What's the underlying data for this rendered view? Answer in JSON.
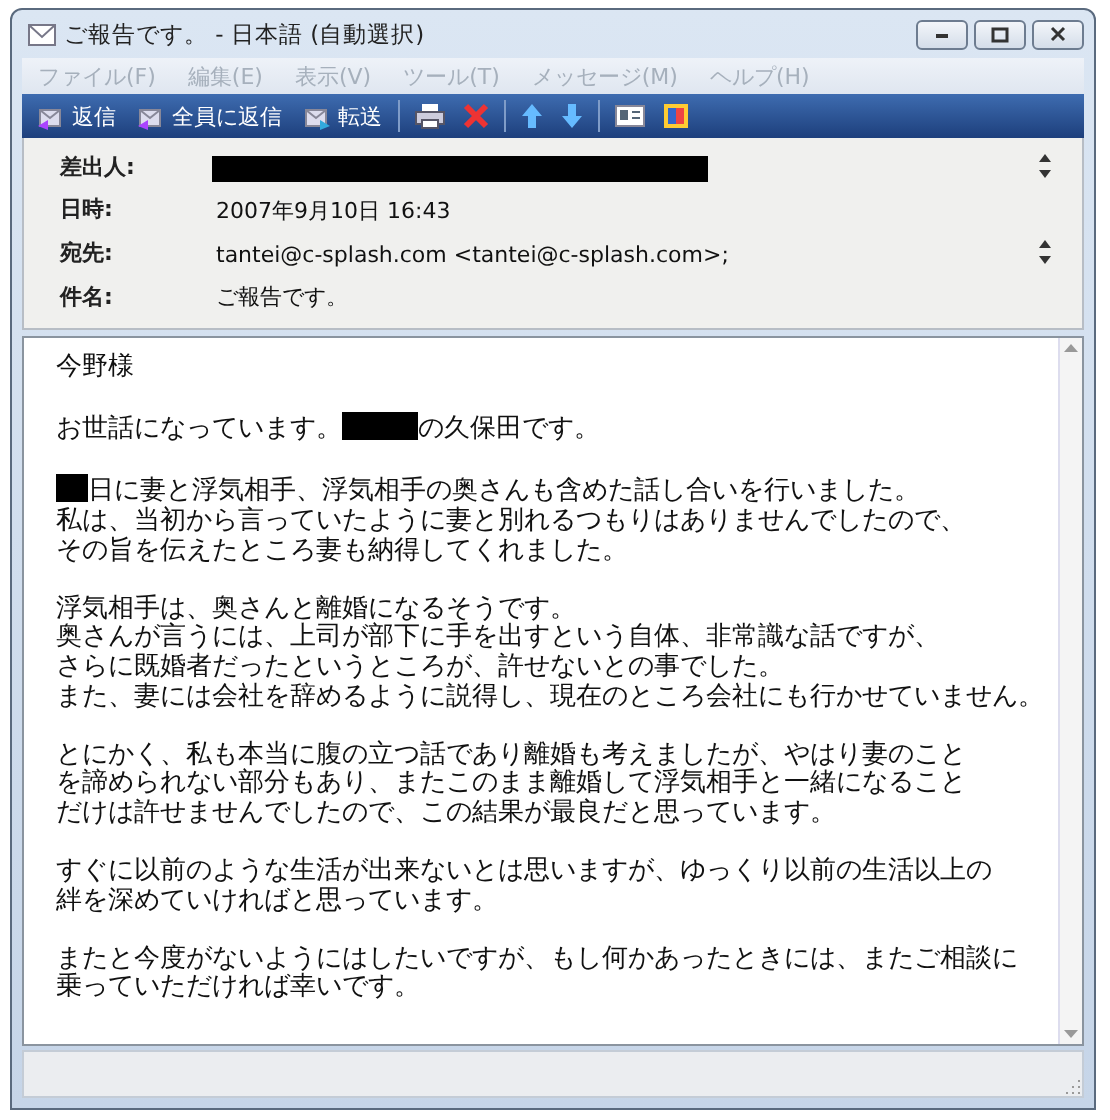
{
  "window": {
    "title": "ご報告です。 - 日本語 (自動選択)"
  },
  "menu": [
    "ファイル(F)",
    "編集(E)",
    "表示(V)",
    "ツール(T)",
    "メッセージ(M)",
    "ヘルプ(H)"
  ],
  "toolbar": [
    {
      "kind": "reply",
      "label": "返信"
    },
    {
      "kind": "reply-all",
      "label": "全員に返信"
    },
    {
      "kind": "forward",
      "label": "転送"
    },
    {
      "kind": "print"
    },
    {
      "kind": "delete"
    },
    {
      "kind": "previous"
    },
    {
      "kind": "next"
    },
    {
      "kind": "contacts"
    },
    {
      "kind": "encoding"
    }
  ],
  "header": [
    {
      "label": "差出人:",
      "redacted": true,
      "scroll": true
    },
    {
      "label": "日時:",
      "value": "2007年9月10日 16:43",
      "redacted": false,
      "scroll": false
    },
    {
      "label": "宛先:",
      "value": "tantei@c-splash.com <tantei@c-splash.com>;",
      "redacted": false,
      "scroll": true
    },
    {
      "label": "件名:",
      "value": "ご報告です。",
      "redacted": false,
      "scroll": false
    }
  ],
  "body": [
    [
      [
        {
          "kind": "text",
          "text": "今野様"
        }
      ]
    ],
    [
      [
        {
          "kind": "text",
          "text": "お世話になっています。"
        },
        {
          "kind": "redacted"
        },
        {
          "kind": "text",
          "text": "の久保田です。"
        }
      ]
    ],
    [
      [
        {
          "kind": "redacted"
        },
        {
          "kind": "text",
          "text": "日に妻と浮気相手、浮気相手の奥さんも含めた話し合いを行いました。"
        }
      ],
      [
        {
          "kind": "text",
          "text": "私は、当初から言っていたように妻と別れるつもりはありませんでしたので、"
        }
      ],
      [
        {
          "kind": "text",
          "text": "その旨を伝えたところ妻も納得してくれました。"
        }
      ]
    ],
    [
      [
        {
          "kind": "text",
          "text": "浮気相手は、奥さんと離婚になるそうです。"
        }
      ],
      [
        {
          "kind": "text",
          "text": "奥さんが言うには、上司が部下に手を出すという自体、非常識な話ですが、"
        }
      ],
      [
        {
          "kind": "text",
          "text": "さらに既婚者だったというところが、許せないとの事でした。"
        }
      ],
      [
        {
          "kind": "text",
          "text": "また、妻には会社を辞めるように説得し、現在のところ会社にも行かせていません。"
        }
      ]
    ],
    [
      [
        {
          "kind": "text",
          "text": "とにかく、私も本当に腹の立つ話であり離婚も考えましたが、やはり妻のこと"
        }
      ],
      [
        {
          "kind": "text",
          "text": "を諦められない部分もあり、またこのまま離婚して浮気相手と一緒になること"
        }
      ],
      [
        {
          "kind": "text",
          "text": "だけは許せませんでしたので、この結果が最良だと思っています。"
        }
      ]
    ],
    [
      [
        {
          "kind": "text",
          "text": "すぐに以前のような生活が出来ないとは思いますが、ゆっくり以前の生活以上の"
        }
      ],
      [
        {
          "kind": "text",
          "text": "絆を深めていければと思っています。"
        }
      ]
    ],
    [
      [
        {
          "kind": "text",
          "text": "またと今度がないようにはしたいですが、もし何かあったときには、またご相談に"
        }
      ],
      [
        {
          "kind": "text",
          "text": "乗っていただければ幸いです。"
        }
      ]
    ]
  ]
}
